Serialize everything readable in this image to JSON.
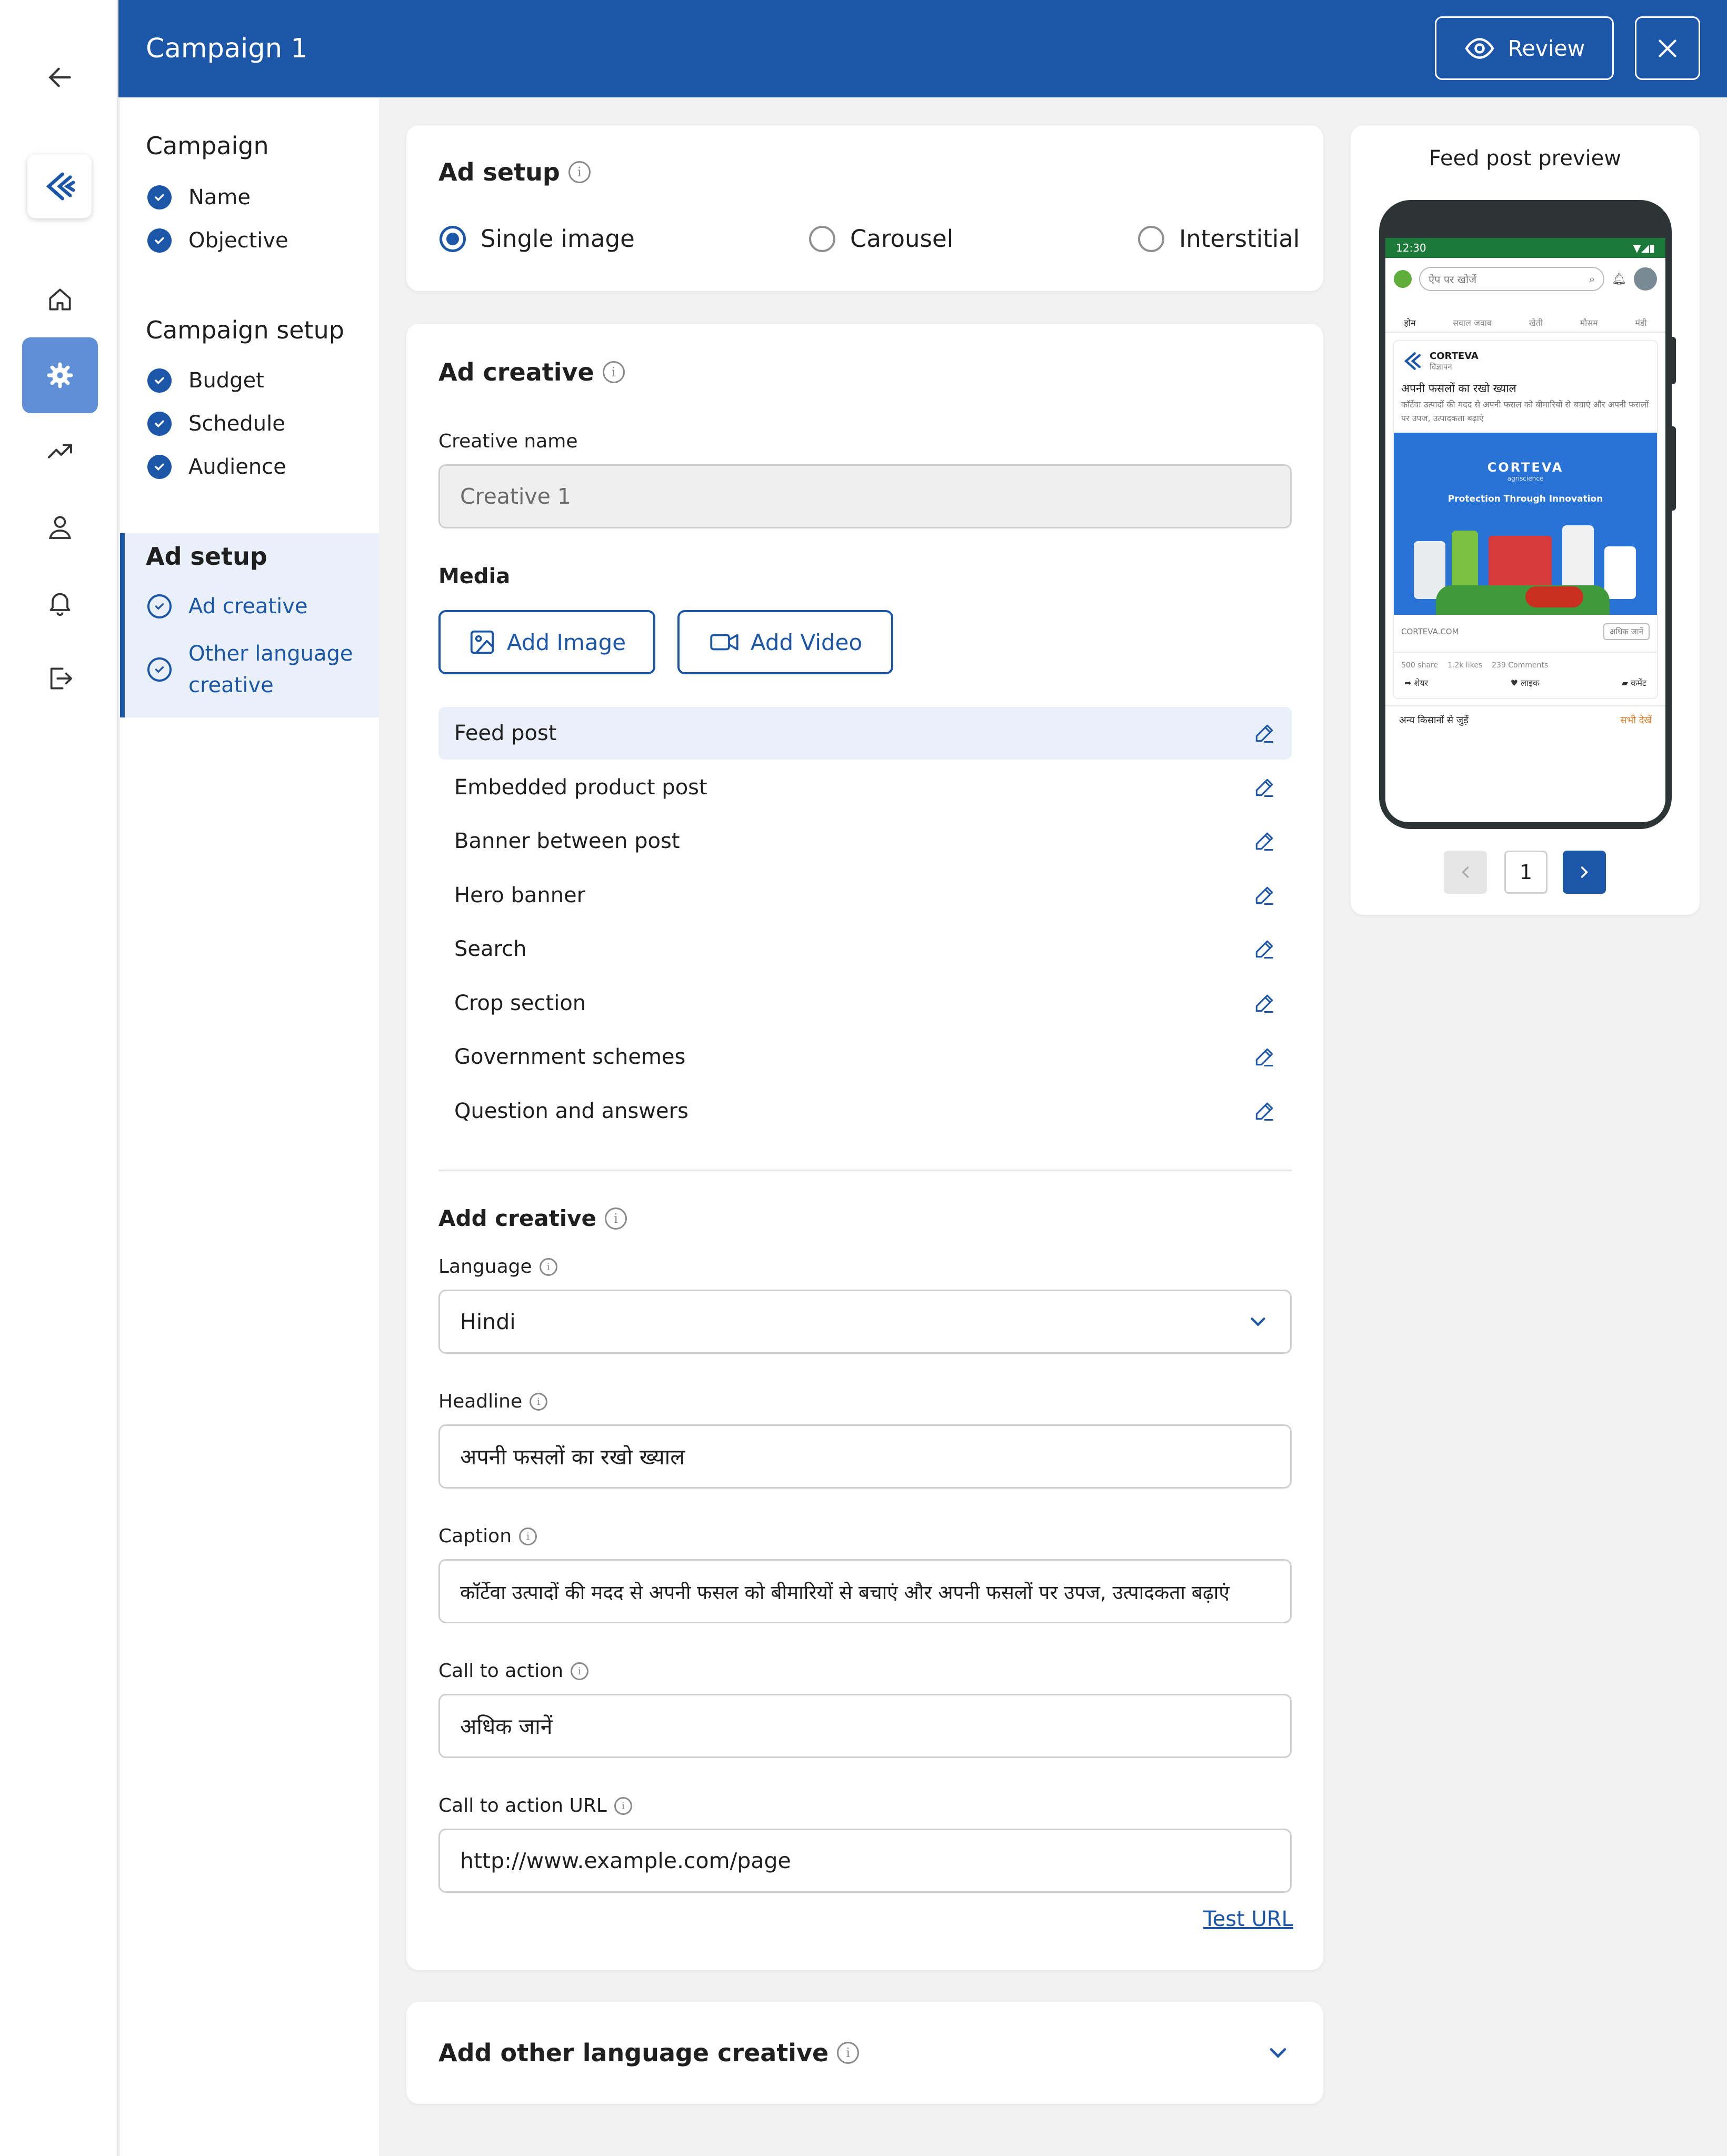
{
  "header": {
    "title": "Campaign 1",
    "review_label": "Review"
  },
  "nav": {
    "sections": [
      {
        "title": "Campaign",
        "items": [
          "Name",
          "Objective"
        ]
      },
      {
        "title": "Campaign setup",
        "items": [
          "Budget",
          "Schedule",
          "Audience"
        ]
      },
      {
        "title": "Ad setup",
        "items": [
          "Ad creative",
          "Other language creative"
        ]
      }
    ],
    "other_language_line1": "Other language",
    "other_language_line2": "creative"
  },
  "ad_setup": {
    "title": "Ad setup",
    "options": [
      "Single image",
      "Carousel",
      "Interstitial"
    ],
    "selected": "Single image"
  },
  "ad_creative": {
    "title": "Ad creative",
    "creative_name_label": "Creative name",
    "creative_name_placeholder": "Creative 1",
    "media_label": "Media",
    "add_image_label": "Add Image",
    "add_video_label": "Add Video",
    "placements": [
      "Feed post",
      "Embedded product post",
      "Banner between post",
      "Hero banner",
      "Search",
      "Crop section",
      "Government schemes",
      "Question and answers"
    ],
    "selected_placement": "Feed post"
  },
  "add_creative": {
    "title": "Add creative",
    "language_label": "Language",
    "language_value": "Hindi",
    "headline_label": "Headline",
    "headline_value": "अपनी फसलों का रखो ख्याल",
    "caption_label": "Caption",
    "caption_value": "कॉर्टेवा उत्पादों की मदद से अपनी फसल को बीमारियों से बचाएं और अपनी फसलों पर उपज, उत्पादकता बढ़ाएं",
    "cta_label": "Call to action",
    "cta_value": "अधिक जानें",
    "cta_url_label": "Call to action URL",
    "cta_url_value": "http://www.example.com/page",
    "test_url_label": "Test URL"
  },
  "other_language": {
    "title": "Add other language creative"
  },
  "preview": {
    "title": "Feed post preview",
    "page": "1",
    "phone": {
      "time": "12:30",
      "search_placeholder": "ऐप पर खोजें",
      "tabs": [
        "होम",
        "सवाल जवाब",
        "खेती",
        "मौसम",
        "मंडी"
      ],
      "brand": "CORTEVA",
      "sponsored": "विज्ञापन",
      "headline": "अपनी फसलों का रखो ख्याल",
      "caption": "कॉर्टेवा उत्पादों की मदद से अपनी फसल को बीमारियों से बचाएं और अपनी फसलों पर उपज, उत्पादकता बढ़ाएं",
      "banner_brand": "CORTEVA",
      "banner_sub": "agriscience",
      "banner_tagline": "Protection Through Innovation",
      "domain": "CORTEVA.COM",
      "cta": "अधिक जानें",
      "shares": "500 share",
      "likes": "1.2k likes",
      "comments": "239 Comments",
      "share_label": "शेयर",
      "like_label": "लाइक",
      "comment_label": "कमेंट",
      "footer_text": "अन्य किसानों से जुड़ें",
      "footer_link": "सभी देखें"
    }
  },
  "colors": {
    "primary": "#1b56a8",
    "rail_active": "#5f8fd6",
    "selected_bg": "#e9f0fa"
  }
}
